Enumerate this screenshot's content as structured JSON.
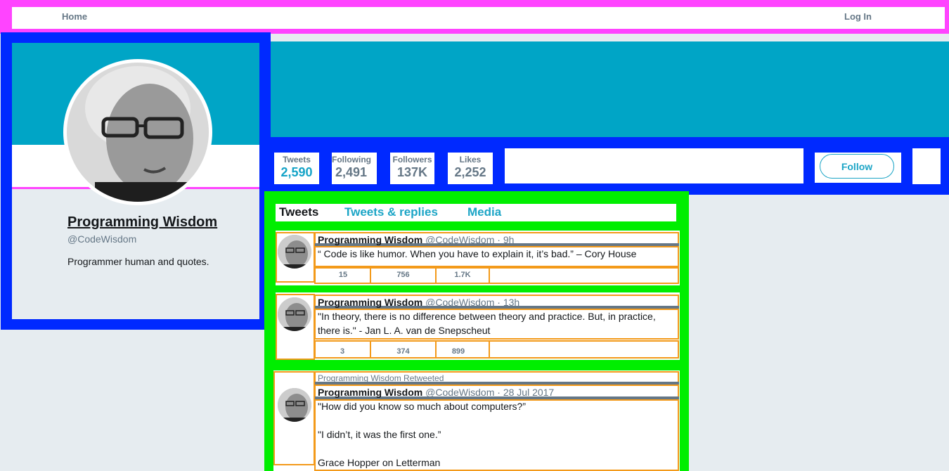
{
  "nav": {
    "home": "Home",
    "login": "Log In"
  },
  "profile": {
    "name": "Programming Wisdom",
    "handle": "@CodeWisdom",
    "bio": "Programmer human and quotes."
  },
  "stats": [
    {
      "label": "Tweets",
      "value": "2,590"
    },
    {
      "label": "Following",
      "value": "2,491"
    },
    {
      "label": "Followers",
      "value": "137K"
    },
    {
      "label": "Likes",
      "value": "2,252"
    }
  ],
  "follow_label": "Follow",
  "tabs": [
    "Tweets",
    "Tweets & replies",
    "Media"
  ],
  "tweets": [
    {
      "name": "Programming Wisdom",
      "handle": "@CodeWisdom",
      "time": "· 9h",
      "text": "“ Code is like humor. When you have to explain it, it’s bad.” – Cory House",
      "replies": "15",
      "retweets": "756",
      "likes": "1.7K"
    },
    {
      "name": "Programming Wisdom",
      "handle": "@CodeWisdom",
      "time": "· 13h",
      "text": "\"In theory, there is no difference between theory and practice. But, in practice, there is.\" - Jan L. A. van de Snepscheut",
      "replies": "3",
      "retweets": "374",
      "likes": "899"
    },
    {
      "retweeted_label": "Programming Wisdom Retweeted",
      "name": "Programming Wisdom",
      "handle": "@CodeWisdom",
      "time": "· 28 Jul 2017",
      "text_lines": [
        "\"How did you know so much about computers?”",
        "\"I didn’t, it was the first one.”",
        "Grace Hopper on Letterman"
      ]
    }
  ],
  "colors": {
    "teal": "#00a5c6",
    "blue_frame": "#0029ff",
    "magenta_frame": "#ff44ff",
    "green_frame": "#00ee00",
    "orange_outline": "#f39a1a"
  }
}
